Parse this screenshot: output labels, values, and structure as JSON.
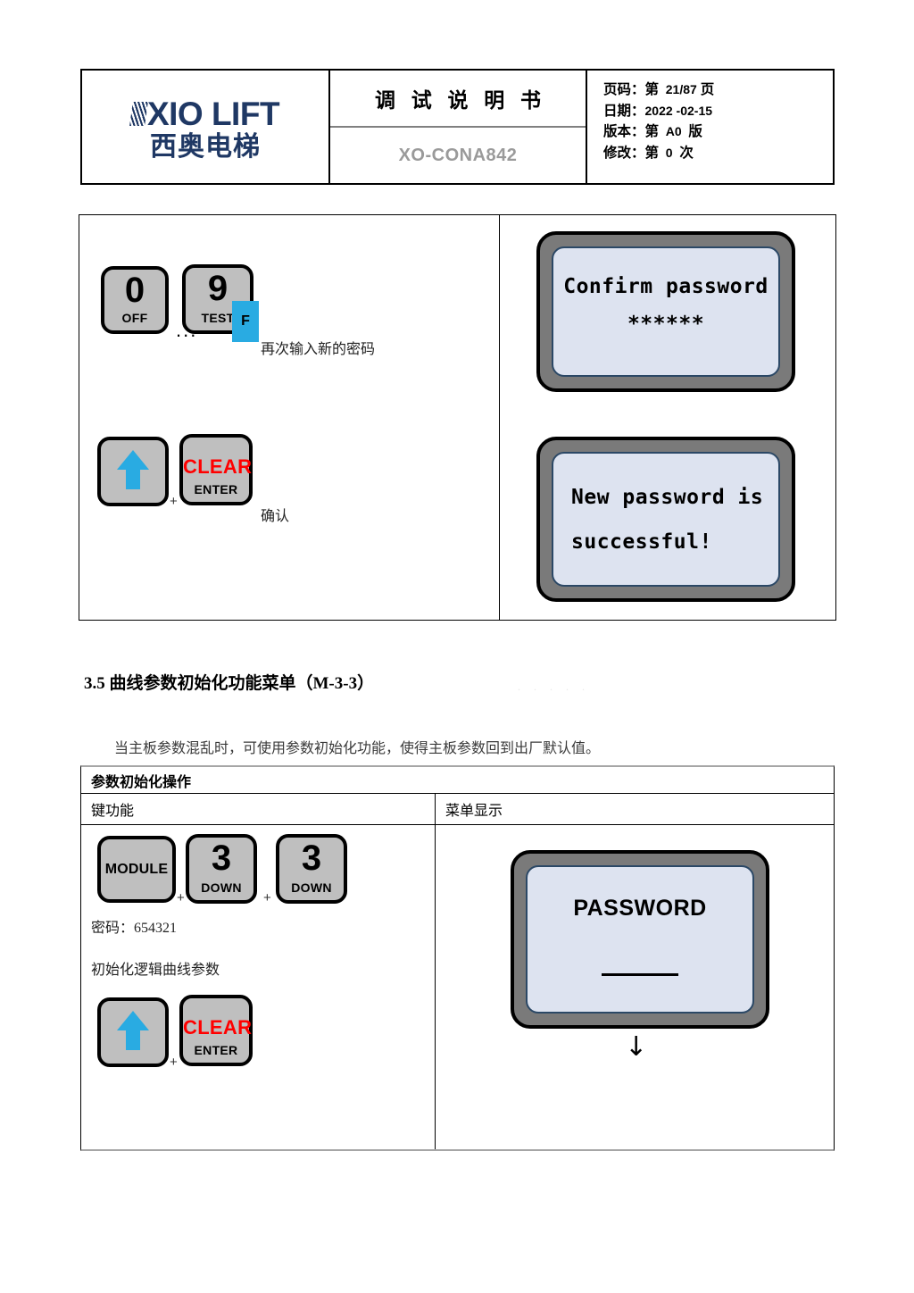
{
  "header": {
    "logo": {
      "brand_en": "XIO LIFT",
      "brand_cn": "西奥电梯"
    },
    "title": "调 试 说 明 书",
    "doc_code": "XO-CONA842",
    "meta": [
      {
        "label": "页码：第",
        "value": "21/87",
        "suffix": "页"
      },
      {
        "label": "日期：",
        "value": "2022 -02-15",
        "suffix": ""
      },
      {
        "label": "版本：第",
        "value": "A0",
        "suffix": "版"
      },
      {
        "label": "修改：第",
        "value": "0",
        "suffix": "次"
      }
    ]
  },
  "panel_top": {
    "left": {
      "row1": {
        "key_a": {
          "big": "0",
          "sub": "OFF"
        },
        "ellipsis": "...",
        "key_b": {
          "big": "9",
          "sub": "TEST"
        },
        "f_tab": "F",
        "annotation": "再次输入新的密码"
      },
      "row2": {
        "key_up": {
          "icon": "up-arrow-icon"
        },
        "plus": "+",
        "key_clear": {
          "main": "CLEAR",
          "sub": "ENTER"
        },
        "annotation": "确认"
      }
    },
    "right": {
      "display1": {
        "line1": "Confirm password",
        "line2": "******"
      },
      "display2": {
        "line1": "New password is",
        "line2": "successful!"
      }
    }
  },
  "section": {
    "heading": "3.5 曲线参数初始化功能菜单（M-3-3）",
    "leader_dots": ". . . . .",
    "paragraph": "当主板参数混乱时，可使用参数初始化功能，使得主板参数回到出厂默认值。"
  },
  "table": {
    "title": "参数初始化操作",
    "col_headers": [
      "键功能",
      "菜单显示"
    ],
    "body": {
      "keys": {
        "key_module": {
          "label": "MODULE"
        },
        "plus1": "+",
        "key_down1": {
          "big": "3",
          "sub": "DOWN"
        },
        "plus2": "+",
        "key_down2": {
          "big": "3",
          "sub": "DOWN"
        },
        "password_text": "密码：654321",
        "init_text": "初始化逻辑曲线参数",
        "key_up": {
          "icon": "up-arrow-icon"
        },
        "plus3": "+",
        "key_clear": {
          "main": "CLEAR",
          "sub": "ENTER"
        }
      },
      "display": {
        "line1": "PASSWORD",
        "line2": "______",
        "arrow": "↓"
      }
    }
  },
  "colors": {
    "brand_navy": "#1F3864",
    "key_face": "#bfbfbf",
    "accent_cyan": "#29ABE2",
    "clear_red": "#FF0000",
    "lcd_bezel": "#7a7a7a",
    "lcd_screen": "#dde3f0",
    "doc_code_gray": "#9a9a9a"
  }
}
